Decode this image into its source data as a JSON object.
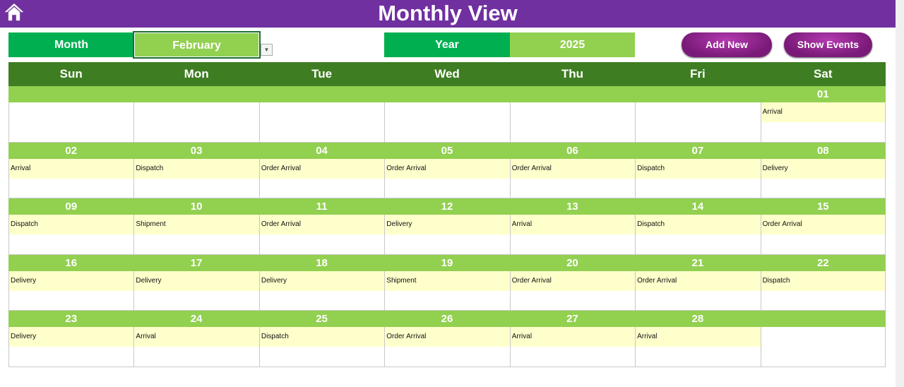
{
  "header": {
    "title": "Monthly View",
    "home_icon": "home-icon"
  },
  "controls": {
    "month_label": "Month",
    "month_value": "February",
    "year_label": "Year",
    "year_value": "2025",
    "add_new": "Add New",
    "show_events": "Show Events"
  },
  "colors": {
    "header": "#7030A0",
    "label": "#00B050",
    "value": "#92D050",
    "day_header": "#3E7D22",
    "event_bg": "#FFFFCC",
    "button": "#8B2089"
  },
  "days": [
    "Sun",
    "Mon",
    "Tue",
    "Wed",
    "Thu",
    "Fri",
    "Sat"
  ],
  "weeks": [
    [
      {
        "date": "",
        "event": ""
      },
      {
        "date": "",
        "event": ""
      },
      {
        "date": "",
        "event": ""
      },
      {
        "date": "",
        "event": ""
      },
      {
        "date": "",
        "event": ""
      },
      {
        "date": "",
        "event": ""
      },
      {
        "date": "01",
        "event": "Arrival"
      }
    ],
    [
      {
        "date": "02",
        "event": "Arrival"
      },
      {
        "date": "03",
        "event": "Dispatch"
      },
      {
        "date": "04",
        "event": "Order Arrival"
      },
      {
        "date": "05",
        "event": "Order Arrival"
      },
      {
        "date": "06",
        "event": "Order Arrival"
      },
      {
        "date": "07",
        "event": "Dispatch"
      },
      {
        "date": "08",
        "event": "Delivery"
      }
    ],
    [
      {
        "date": "09",
        "event": "Dispatch"
      },
      {
        "date": "10",
        "event": "Shipment"
      },
      {
        "date": "11",
        "event": "Order Arrival"
      },
      {
        "date": "12",
        "event": "Delivery"
      },
      {
        "date": "13",
        "event": "Arrival"
      },
      {
        "date": "14",
        "event": "Dispatch"
      },
      {
        "date": "15",
        "event": "Order Arrival"
      }
    ],
    [
      {
        "date": "16",
        "event": "Delivery"
      },
      {
        "date": "17",
        "event": "Delivery"
      },
      {
        "date": "18",
        "event": "Delivery"
      },
      {
        "date": "19",
        "event": "Shipment"
      },
      {
        "date": "20",
        "event": "Order Arrival"
      },
      {
        "date": "21",
        "event": "Order Arrival"
      },
      {
        "date": "22",
        "event": "Dispatch"
      }
    ],
    [
      {
        "date": "23",
        "event": "Delivery"
      },
      {
        "date": "24",
        "event": "Arrival"
      },
      {
        "date": "25",
        "event": "Dispatch"
      },
      {
        "date": "26",
        "event": "Order Arrival"
      },
      {
        "date": "27",
        "event": "Arrival"
      },
      {
        "date": "28",
        "event": "Arrival"
      },
      {
        "date": "",
        "event": ""
      }
    ]
  ]
}
